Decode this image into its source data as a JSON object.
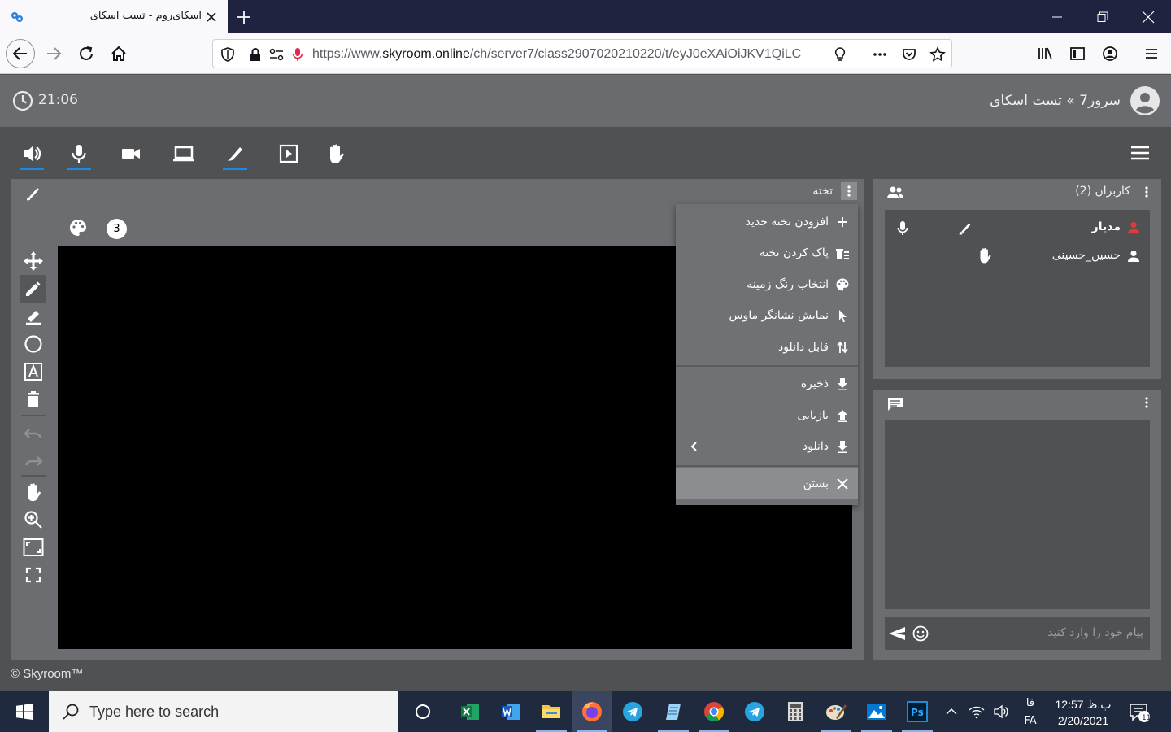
{
  "browser": {
    "tab_title": "اسکای‌روم - تست اسکای",
    "url_prefix": "https://www.",
    "url_host": "skyroom.online",
    "url_path": "/ch/server7/class2907020210220/t/eyJ0eXAiOiJKV1QiLC",
    "icons": [
      "shield-icon",
      "lock-icon",
      "permissions-icon",
      "microphone-icon",
      "bulb-icon",
      "more-icon",
      "pocket-icon",
      "star-icon",
      "library-icon",
      "sidebar-icon",
      "account-icon",
      "menu-icon"
    ]
  },
  "app": {
    "time": "21:06",
    "breadcrumb": "سرور7 » تست اسکای",
    "toolbar_icons": [
      "speaker-icon",
      "mic-icon",
      "camera-icon",
      "screen-share-icon",
      "whiteboard-icon",
      "presentation-icon",
      "raise-hand-icon"
    ],
    "accent_color": "#1e88e5"
  },
  "whiteboard": {
    "title": "تخته",
    "page_number": "3",
    "tools": [
      "move-icon",
      "pencil-icon",
      "highlighter-icon",
      "circle-icon",
      "text-icon",
      "trash-icon",
      "undo-icon",
      "redo-icon",
      "pan-icon",
      "zoom-icon",
      "fit-icon",
      "fullscreen-icon"
    ]
  },
  "menu": {
    "items": [
      {
        "label": "افزودن تخته جدید",
        "icon": "plus-icon"
      },
      {
        "label": "پاک کردن تخته",
        "icon": "clear-board-icon"
      },
      {
        "label": "انتخاب رنگ زمینه",
        "icon": "palette-icon"
      },
      {
        "label": "نمایش نشانگر ماوس",
        "icon": "cursor-icon"
      },
      {
        "label": "قابل دانلود",
        "icon": "swap-icon"
      },
      {
        "label": "ذخیره",
        "icon": "download-icon"
      },
      {
        "label": "بازیابی",
        "icon": "upload-icon"
      },
      {
        "label": "دانلود",
        "icon": "download-icon"
      },
      {
        "label": "بستن",
        "icon": "close-icon"
      }
    ]
  },
  "users": {
    "title": "کاربران (2)",
    "list": [
      {
        "name": "مدیار",
        "role": "admin"
      },
      {
        "name": "حسین‌_حسینی",
        "role": "user"
      }
    ],
    "admin_color": "#e53935"
  },
  "chat": {
    "placeholder": "پیام خود را وارد کنید"
  },
  "footer": "© Skyroom™",
  "taskbar": {
    "search_placeholder": "Type here to search",
    "lang": "فا",
    "lang2": "FA",
    "time": "12:57 ب.ظ",
    "date": "2/20/2021",
    "apps": [
      "cortana-icon",
      "excel-icon",
      "word-icon",
      "explorer-icon",
      "firefox-icon",
      "telegram-icon",
      "notepad-icon",
      "chrome-icon",
      "telegram-icon",
      "calculator-icon",
      "paint-icon",
      "photos-icon",
      "photoshop-icon"
    ]
  }
}
